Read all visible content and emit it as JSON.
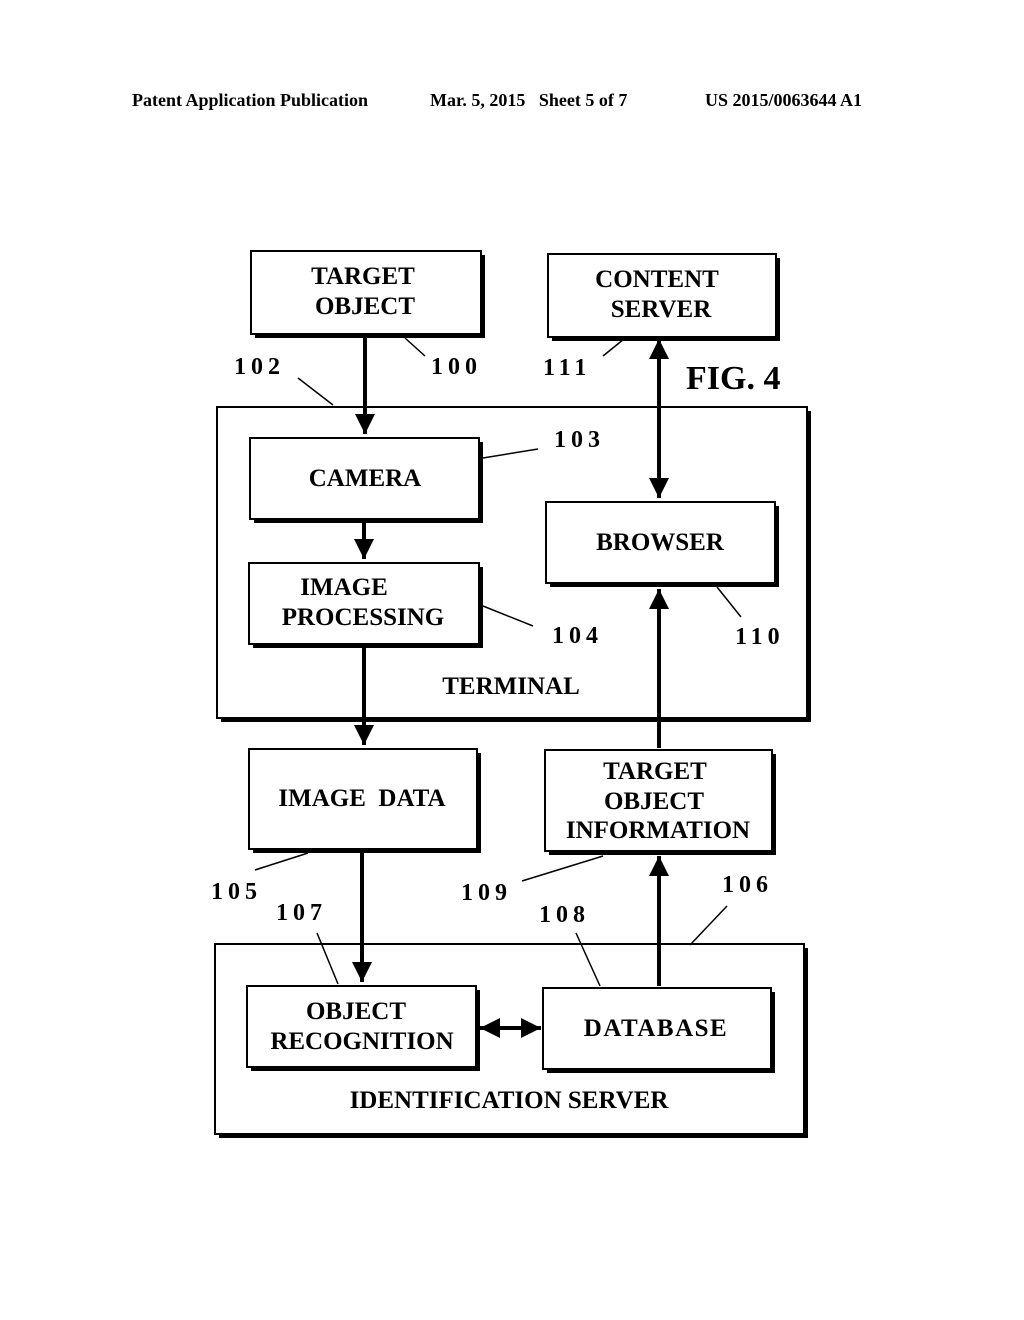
{
  "header": {
    "publication": "Patent Application Publication",
    "date_sheet": "Mar. 5, 2015   Sheet 5 of 7",
    "patent_number": "US 2015/0063644 A1"
  },
  "figure": {
    "label": "FIG. 4"
  },
  "containers": {
    "terminal": {
      "label": "TERMINAL"
    },
    "identification_server": {
      "label": "IDENTIFICATION SERVER"
    }
  },
  "blocks": {
    "target_object": {
      "lines": [
        "TARGET",
        "OBJECT"
      ],
      "ref": "100"
    },
    "content_server": {
      "lines": [
        "CONTENT",
        "SERVER"
      ],
      "ref": "111"
    },
    "camera": {
      "lines": [
        "CAMERA"
      ],
      "ref": "103"
    },
    "image_processing": {
      "lines": [
        "IMAGE",
        "PROCESSING"
      ],
      "ref": "104"
    },
    "browser": {
      "lines": [
        "BROWSER"
      ],
      "ref": "110"
    },
    "image_data": {
      "lines": [
        "IMAGE  DATA"
      ],
      "ref": "105"
    },
    "target_object_information": {
      "lines": [
        "TARGET",
        "OBJECT",
        "INFORMATION"
      ],
      "ref": "109"
    },
    "object_recognition": {
      "lines": [
        "OBJECT",
        "RECOGNITION"
      ],
      "ref": "107"
    },
    "database": {
      "lines": [
        "DATABASE"
      ],
      "ref": "108"
    }
  },
  "refs": {
    "terminal": "102",
    "identification_server": "106"
  }
}
